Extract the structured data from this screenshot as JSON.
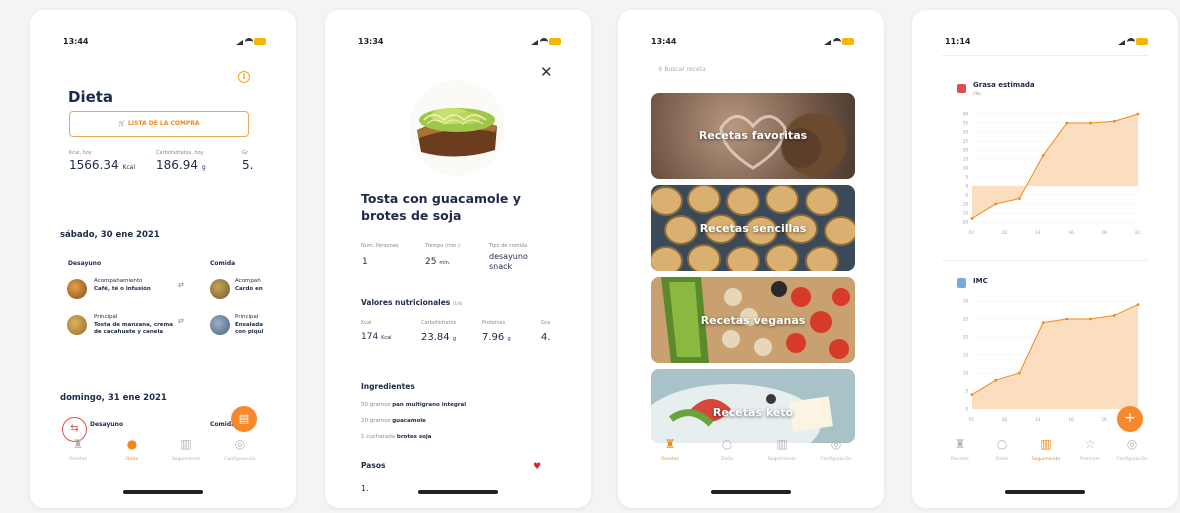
{
  "colors": {
    "accent": "#f08a1c",
    "navy": "#1e2a4a",
    "muted": "#b5b5b5"
  },
  "screen1": {
    "time": "13:44",
    "title": "Dieta",
    "shopping_button": "LISTA DE LA COMPRA",
    "kcal_label": "Kcal. hoy",
    "kcal_value": "1566.34",
    "kcal_unit": "Kcal",
    "carbs_label": "Carbohidratos. hoy",
    "carbs_value": "186.94",
    "carbs_unit": "g",
    "third_label": "Gr",
    "third_value": "5.",
    "day1": "sábado, 30 ene 2021",
    "meal1": "Desayuno",
    "meal2": "Comida",
    "items": [
      {
        "title": "Acompañamiento",
        "desc": "Café, té o infusión"
      },
      {
        "title": "Principal",
        "desc": "Tosta de manzana, crema de cacahuete y canela"
      }
    ],
    "items_col2": [
      {
        "title": "Acompañ",
        "desc": "Cardo en"
      },
      {
        "title": "Principal",
        "desc": "Ensalada con piqui"
      }
    ],
    "day2": "domingo, 31 ene 2021",
    "meal3": "Desayuno",
    "meal4": "Comida",
    "tabs": [
      "Recetas",
      "Dieta",
      "Seguimiento",
      "Configuración"
    ]
  },
  "screen2": {
    "time": "13:34",
    "close_icon": "close-icon",
    "title": "Tosta con guacamole y brotes de soja",
    "persons_label": "Num. Personas",
    "persons_value": "1",
    "time_label": "Tiempo (min.)",
    "time_value": "25",
    "time_unit": "min.",
    "type_label": "Tipo de comida",
    "type_value": "desayuno snack",
    "nutri_title": "Valores nutricionales",
    "nutri_suffix": "(1/4)",
    "kcal_label": "Kcal",
    "kcal_value": "174",
    "kcal_unit": "Kcal",
    "carb_label": "Carbohidratos",
    "carb_value": "23.84",
    "carb_unit": "g",
    "prot_label": "Proteínas",
    "prot_value": "7.96",
    "prot_unit": "g",
    "gr_label": "Gra",
    "gr_value": "4.",
    "ingredients_title": "Ingredientes",
    "ingredients": [
      {
        "qty": "50 gramos",
        "name": "pan multigrano integral"
      },
      {
        "qty": "20 gramos",
        "name": "guacamole"
      },
      {
        "qty": "1 cucharada",
        "name": "brotes soja"
      }
    ],
    "steps_title": "Pasos",
    "steps_first": "1."
  },
  "screen3": {
    "time": "13:44",
    "search_placeholder": "Buscar receta",
    "cards": [
      "Recetas favoritas",
      "Recetas sencillas",
      "Recetas veganas",
      "Recetas keto"
    ],
    "tabs": [
      "Recetas",
      "Dieta",
      "Seguimiento",
      "Configuración"
    ]
  },
  "screen4": {
    "time": "11:14",
    "chart_data": [
      {
        "type": "area",
        "title": "Grasa estimada",
        "unit": "(%)",
        "yticks": [
          "40",
          "35",
          "30",
          "25",
          "20",
          "15",
          "10",
          "5",
          "0",
          "-5",
          "-10",
          "-15",
          "-20"
        ],
        "xticks": [
          "07.",
          "02.",
          "13.",
          "16.",
          "19.",
          "22."
        ],
        "values": [
          -18,
          -10,
          -7,
          17,
          35,
          35,
          36,
          40
        ],
        "ylim": [
          -20,
          40
        ]
      },
      {
        "type": "area",
        "title": "IMC",
        "yticks": [
          "30",
          "25",
          "20",
          "15",
          "10",
          "5",
          "0"
        ],
        "xticks": [
          "07.",
          "02.",
          "13.",
          "16.",
          "19.",
          "22."
        ],
        "values": [
          4,
          8,
          10,
          24,
          25,
          25,
          26,
          29
        ],
        "ylim": [
          0,
          30
        ]
      }
    ],
    "tabs": [
      "Recetas",
      "Dieta",
      "Seguimiento",
      "Premium",
      "Configuración"
    ]
  }
}
